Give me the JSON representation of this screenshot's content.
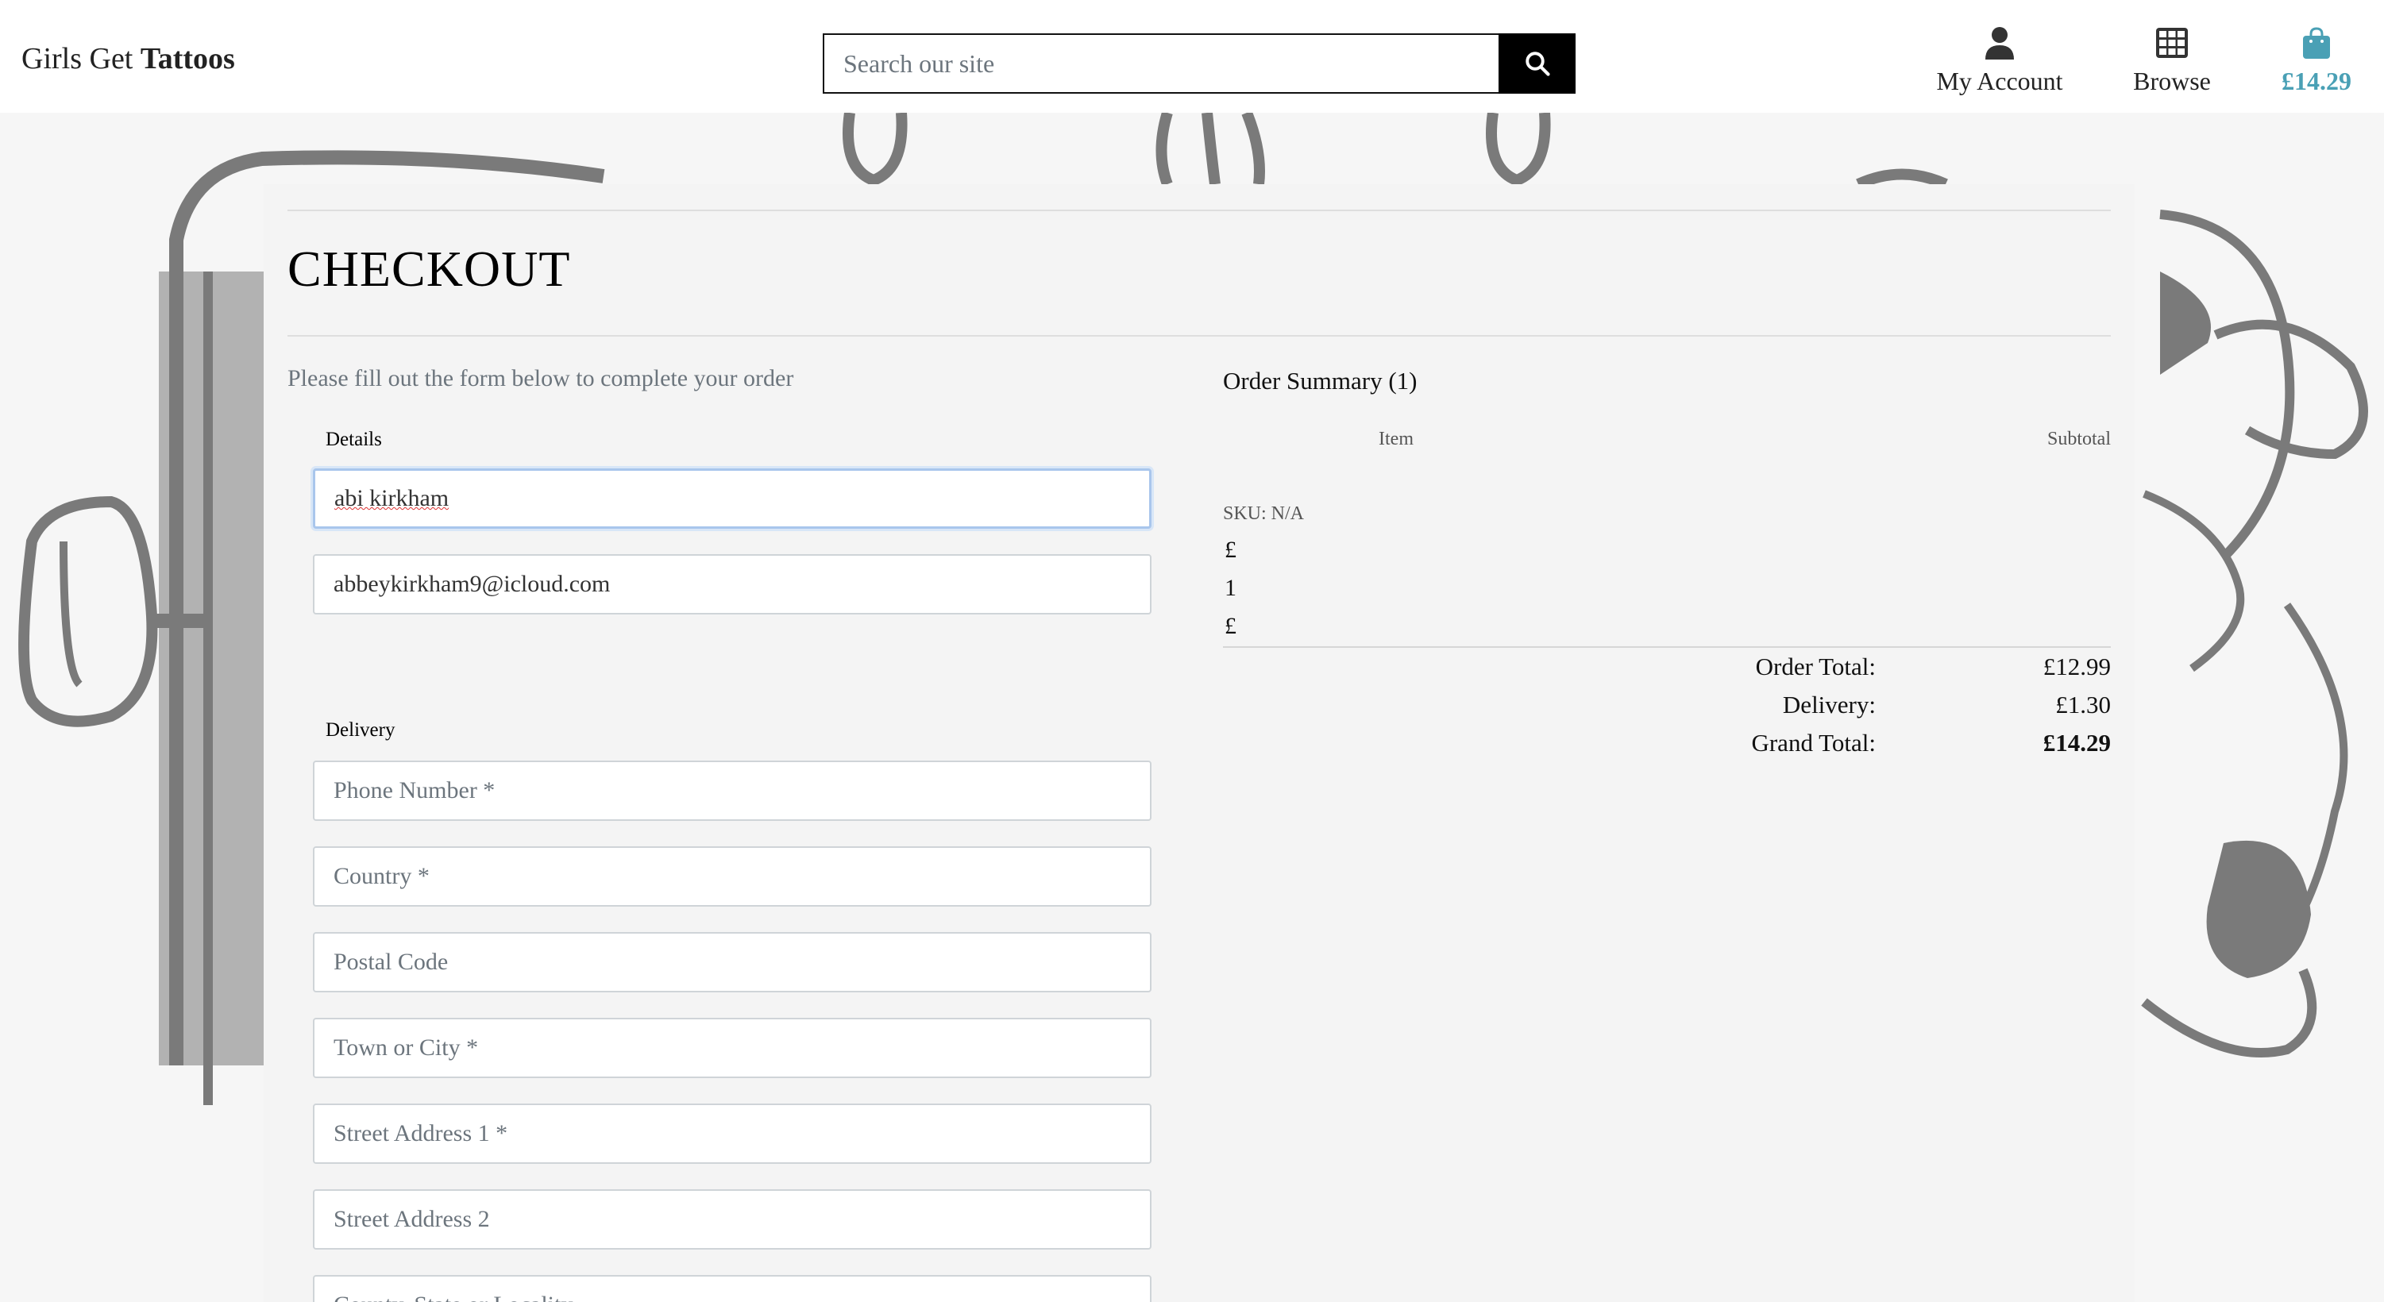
{
  "header": {
    "logo_plain": "Girls Get",
    "logo_bold": "Tattoos",
    "search_placeholder": "Search our site",
    "nav": {
      "account_label": "My Account",
      "browse_label": "Browse",
      "bag_total": "£14.29"
    },
    "colors": {
      "bag_accent": "#4aa0b5",
      "search_button": "#000000"
    }
  },
  "checkout": {
    "title": "CHECKOUT",
    "intro": "Please fill out the form below to complete your order",
    "details": {
      "legend": "Details",
      "full_name_value": "abi kirkham",
      "email_value": "abbeykirkham9@icloud.com"
    },
    "delivery": {
      "legend": "Delivery",
      "phone_placeholder": "Phone Number *",
      "country_placeholder": "Country *",
      "postcode_placeholder": "Postal Code",
      "town_placeholder": "Town or City *",
      "street1_placeholder": "Street Address 1 *",
      "street2_placeholder": "Street Address 2",
      "county_placeholder": "County, State or Locality"
    }
  },
  "order_summary": {
    "title": "Order Summary (1)",
    "col_item": "Item",
    "col_subtotal": "Subtotal",
    "item": {
      "sku": "SKU: N/A",
      "price": "£",
      "quantity": "1",
      "subtotal": "£"
    },
    "order_total_label": "Order Total:",
    "order_total_value": "£12.99",
    "delivery_label": "Delivery:",
    "delivery_value": "£1.30",
    "grand_total_label": "Grand Total:",
    "grand_total_value": "£14.29"
  }
}
